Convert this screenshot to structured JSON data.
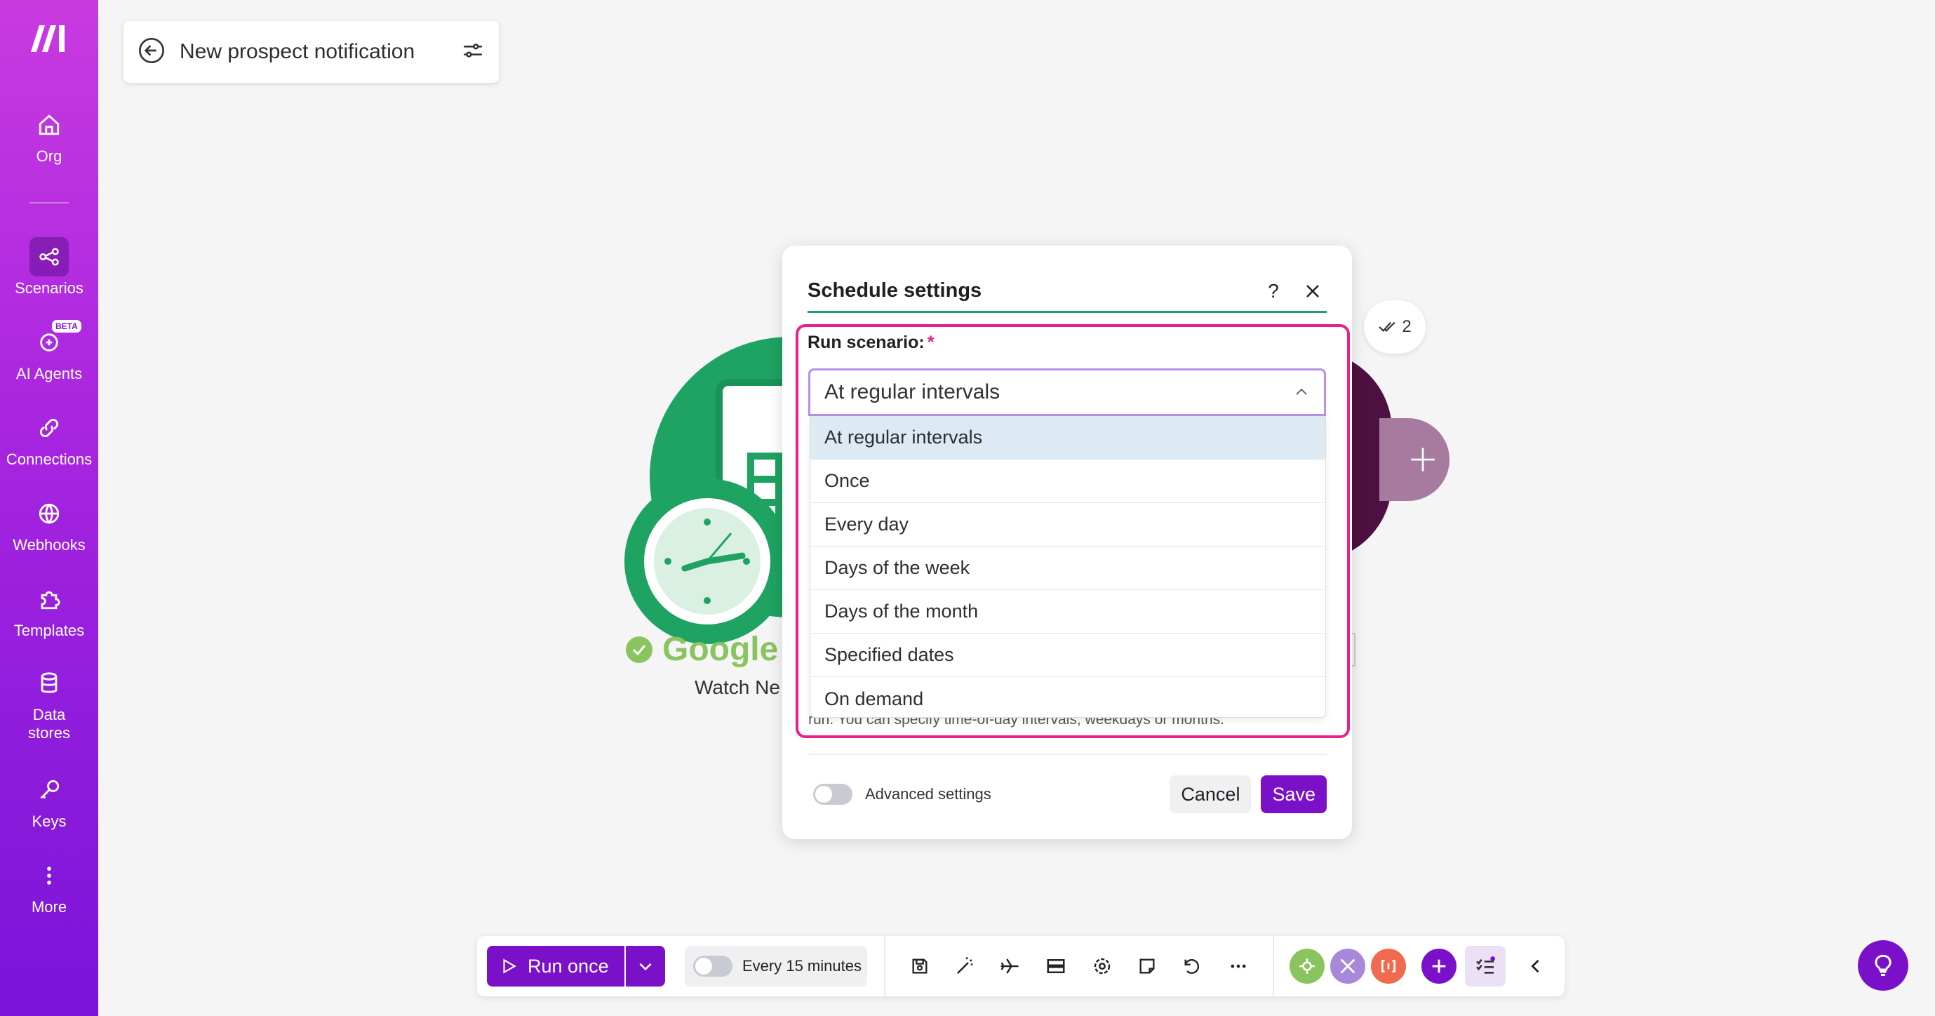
{
  "sidebar": {
    "items": [
      {
        "label": "Org",
        "icon": "home-icon"
      },
      {
        "label": "Scenarios",
        "icon": "share-nodes-icon"
      },
      {
        "label": "AI Agents",
        "icon": "ai-agent-icon",
        "badge": "BETA"
      },
      {
        "label": "Connections",
        "icon": "link-icon"
      },
      {
        "label": "Webhooks",
        "icon": "globe-icon"
      },
      {
        "label": "Templates",
        "icon": "puzzle-icon"
      },
      {
        "label": "Data stores",
        "icon": "database-icon"
      },
      {
        "label": "Keys",
        "icon": "key-icon"
      },
      {
        "label": "More",
        "icon": "more-vertical-icon"
      }
    ],
    "active": "Scenarios"
  },
  "scenario": {
    "title": "New prospect notification"
  },
  "canvas": {
    "module_title": "Google S",
    "module_subtitle": "Watch Ne",
    "check_count": "2"
  },
  "dialog": {
    "title": "Schedule settings",
    "help_label": "?",
    "field_label": "Run scenario:",
    "required_mark": "*",
    "selected_value": "At regular intervals",
    "options": [
      "At regular intervals",
      "Once",
      "Every day",
      "Days of the week",
      "Days of the month",
      "Specified dates",
      "On demand"
    ],
    "help_text": "run. You can specify time-of-day intervals, weekdays or months.",
    "advanced_label": "Advanced settings",
    "cancel_label": "Cancel",
    "save_label": "Save"
  },
  "toolbar": {
    "run_label": "Run once",
    "schedule_label": "Every 15 minutes"
  },
  "colors": {
    "accent": "#7b10c9",
    "highlight": "#e8208a",
    "sidebar_top": "#c93ae0",
    "sidebar_bottom": "#7a14d8",
    "module_green": "#1ea362"
  }
}
